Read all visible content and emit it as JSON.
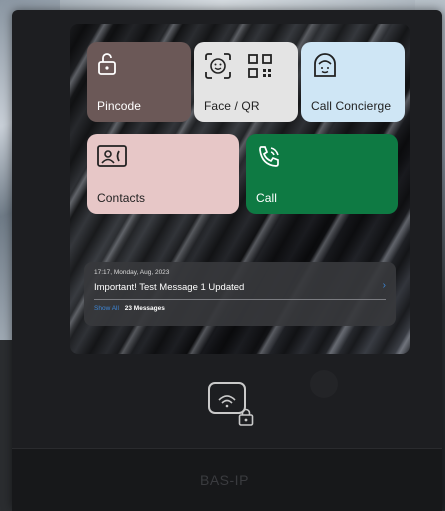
{
  "tiles": {
    "pincode": {
      "label": "Pincode"
    },
    "face_qr": {
      "label": "Face / QR"
    },
    "call_concierge": {
      "label": "Call Concierge"
    },
    "contacts": {
      "label": "Contacts"
    },
    "call": {
      "label": "Call"
    }
  },
  "message": {
    "timestamp": "17:17, Monday, Aug, 2023",
    "title": "Important! Test Message 1 Updated",
    "show_all": "Show All",
    "count": "23 Messages"
  },
  "brand": "BAS-IP",
  "colors": {
    "pincode_tile": "#6b5857",
    "face_tile": "#e4e4e4",
    "concierge_tile": "#cfe6f5",
    "contacts_tile": "#e7c7c7",
    "call_tile": "#0e7a43",
    "accent": "#3d86d6"
  },
  "icons": [
    "lock-icon",
    "face-scan-icon",
    "qr-code-icon",
    "concierge-icon",
    "contacts-card-icon",
    "phone-call-icon",
    "nfc-card-lock-icon"
  ]
}
